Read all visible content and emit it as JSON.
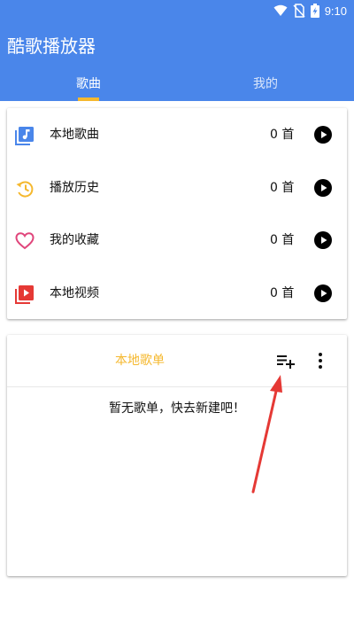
{
  "status_bar": {
    "time": "9:10"
  },
  "app_bar": {
    "title": "酷歌播放器"
  },
  "tabs": [
    {
      "label": "歌曲",
      "selected": true
    },
    {
      "label": "我的",
      "selected": false
    }
  ],
  "library": {
    "items": [
      {
        "label": "本地歌曲",
        "count": "0 首",
        "icon": "music-library-icon",
        "color": "#4a86ea"
      },
      {
        "label": "播放历史",
        "count": "0 首",
        "icon": "history-icon",
        "color": "#f5b82e"
      },
      {
        "label": "我的收藏",
        "count": "0 首",
        "icon": "heart-icon",
        "color": "#e0457b"
      },
      {
        "label": "本地视频",
        "count": "0 首",
        "icon": "video-library-icon",
        "color": "#e53935"
      }
    ]
  },
  "playlist": {
    "title": "本地歌单",
    "empty_text": "暂无歌单，快去新建吧！"
  },
  "colors": {
    "primary": "#4a86ea",
    "accent": "#f5b82e",
    "annotation": "#e53935"
  }
}
